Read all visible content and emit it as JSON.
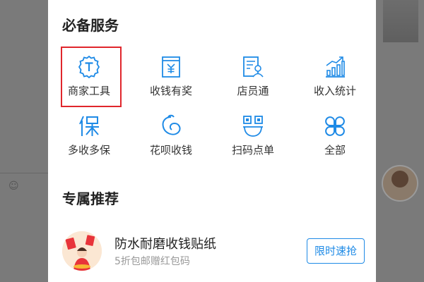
{
  "services": {
    "title": "必备服务",
    "items": [
      {
        "label": "商家工具",
        "icon": "merchant-tools-icon",
        "highlighted": true
      },
      {
        "label": "收钱有奖",
        "icon": "reward-receipt-icon"
      },
      {
        "label": "店员通",
        "icon": "clerk-icon"
      },
      {
        "label": "收入统计",
        "icon": "stats-chart-icon"
      },
      {
        "label": "多收多保",
        "icon": "insurance-icon"
      },
      {
        "label": "花呗收钱",
        "icon": "huabei-icon"
      },
      {
        "label": "扫码点单",
        "icon": "scan-order-icon"
      },
      {
        "label": "全部",
        "icon": "all-grid-icon"
      }
    ]
  },
  "recommend": {
    "title": "专属推荐",
    "promo": {
      "title": "防水耐磨收钱贴纸",
      "subtitle": "5折包邮赠红包码",
      "button": "限时速抢"
    }
  },
  "colors": {
    "accent": "#1e8ae6",
    "highlight": "#e0262c",
    "text": "#222222",
    "subtext": "#999999"
  }
}
